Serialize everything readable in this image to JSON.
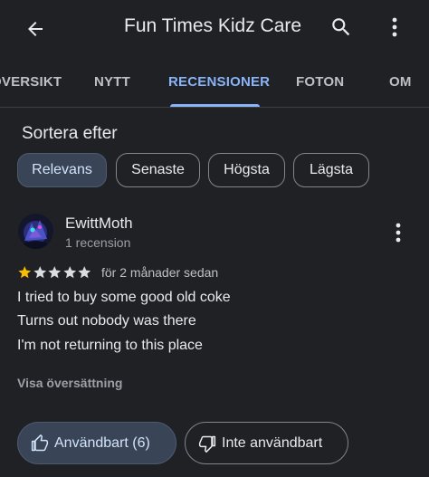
{
  "appbar": {
    "title": "Fun Times Kidz Care",
    "back_icon": "arrow-back-icon",
    "search_icon": "search-icon",
    "more_icon": "more-vert-icon"
  },
  "tabs": [
    {
      "label": "ÖVERSIKT",
      "active": false
    },
    {
      "label": "NYTT",
      "active": false
    },
    {
      "label": "RECENSIONER",
      "active": true
    },
    {
      "label": "FOTON",
      "active": false
    },
    {
      "label": "OM",
      "active": false
    }
  ],
  "sort": {
    "title": "Sortera efter",
    "options": [
      {
        "label": "Relevans",
        "selected": true
      },
      {
        "label": "Senaste",
        "selected": false
      },
      {
        "label": "Högsta",
        "selected": false
      },
      {
        "label": "Lägsta",
        "selected": false
      }
    ]
  },
  "review": {
    "author": "EwittMoth",
    "author_meta": "1 recension",
    "rating": 1,
    "max_rating": 5,
    "date": "för 2 månader sedan",
    "lines": [
      "I tried to buy some good old coke",
      "Turns out nobody was there",
      "I'm not returning to this place"
    ],
    "translate_label": "Visa översättning",
    "helpful_label": "Användbart (6)",
    "not_helpful_label": "Inte användbart"
  },
  "colors": {
    "background": "#202124",
    "accent": "#8ab4f8",
    "star_filled": "#fbbc04",
    "star_empty": "#dadce0"
  }
}
